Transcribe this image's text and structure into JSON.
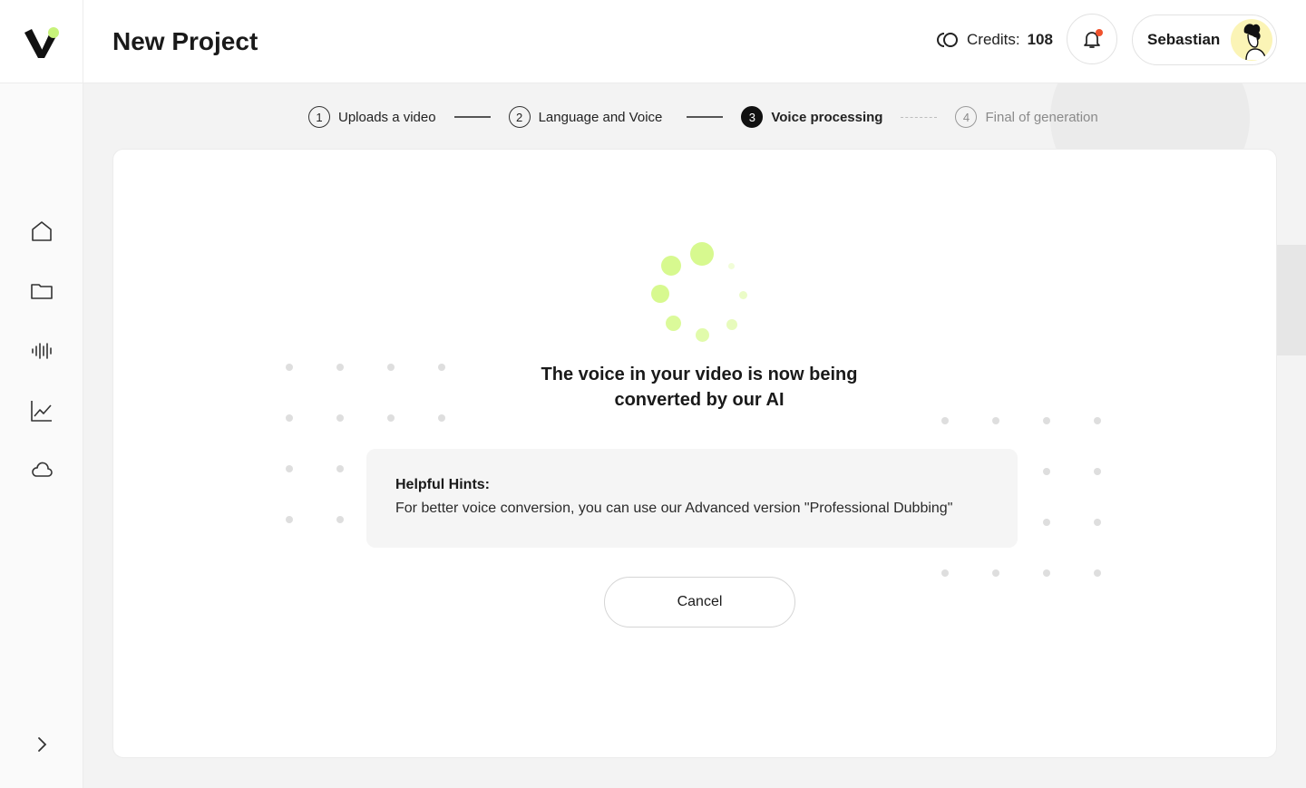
{
  "header": {
    "title": "New Project",
    "credits_label": "Credits:",
    "credits_value": "108",
    "user_name": "Sebastian"
  },
  "sidebar": {
    "items": [
      {
        "icon": "home-icon"
      },
      {
        "icon": "folder-icon"
      },
      {
        "icon": "waveform-icon"
      },
      {
        "icon": "chart-icon"
      },
      {
        "icon": "cloud-icon"
      }
    ],
    "expand_icon": "chevron-right-icon"
  },
  "stepper": {
    "steps": [
      {
        "num": "1",
        "label": "Uploads a video",
        "state": "done"
      },
      {
        "num": "2",
        "label": "Language and Voice",
        "state": "done"
      },
      {
        "num": "3",
        "label": "Voice processing",
        "state": "active"
      },
      {
        "num": "4",
        "label": "Final of generation",
        "state": "pending"
      }
    ]
  },
  "main": {
    "status_line1": "The voice in your video is now being",
    "status_line2": "converted by our AI",
    "hints_title": "Helpful Hints:",
    "hints_text": "For better voice conversion, you can use our Advanced version \"Professional Dubbing\"",
    "cancel_label": "Cancel"
  },
  "colors": {
    "accent": "#d7f98f",
    "notification": "#f0522d"
  }
}
